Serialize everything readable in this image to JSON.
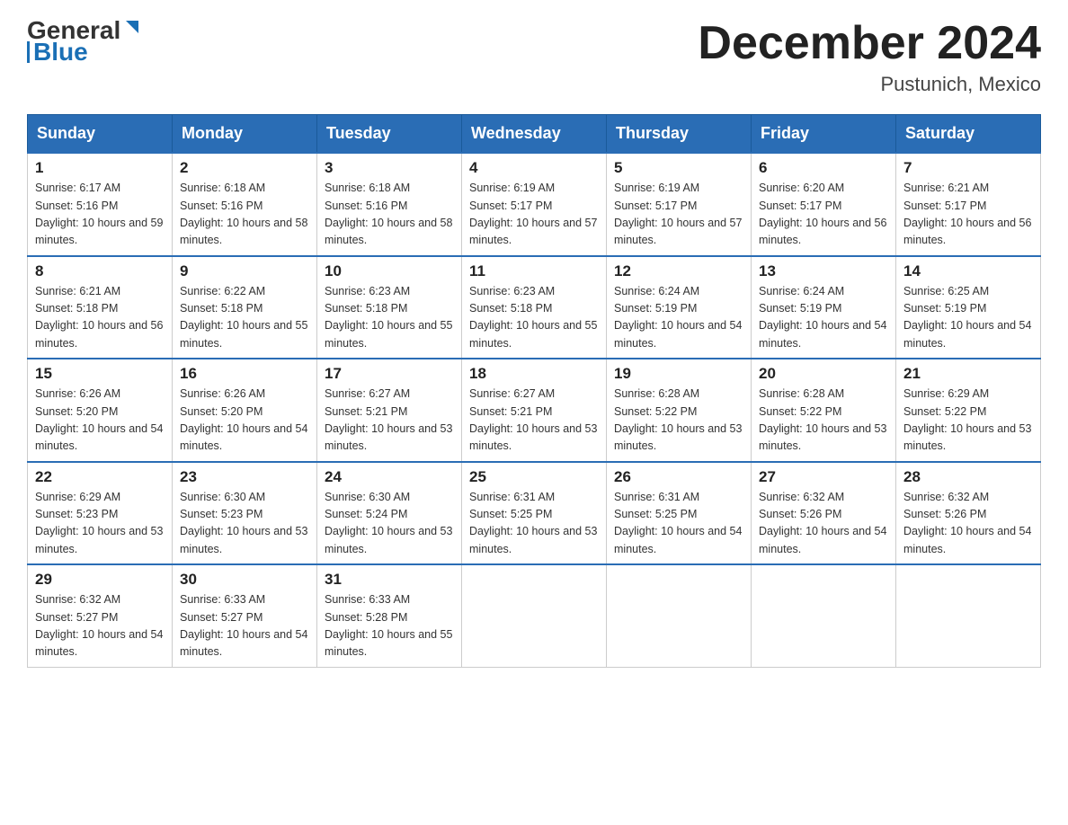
{
  "header": {
    "logo": {
      "text_general": "General",
      "text_blue": "Blue"
    },
    "title": "December 2024",
    "location": "Pustunich, Mexico"
  },
  "days_of_week": [
    "Sunday",
    "Monday",
    "Tuesday",
    "Wednesday",
    "Thursday",
    "Friday",
    "Saturday"
  ],
  "weeks": [
    [
      {
        "day": "1",
        "sunrise": "6:17 AM",
        "sunset": "5:16 PM",
        "daylight": "10 hours and 59 minutes."
      },
      {
        "day": "2",
        "sunrise": "6:18 AM",
        "sunset": "5:16 PM",
        "daylight": "10 hours and 58 minutes."
      },
      {
        "day": "3",
        "sunrise": "6:18 AM",
        "sunset": "5:16 PM",
        "daylight": "10 hours and 58 minutes."
      },
      {
        "day": "4",
        "sunrise": "6:19 AM",
        "sunset": "5:17 PM",
        "daylight": "10 hours and 57 minutes."
      },
      {
        "day": "5",
        "sunrise": "6:19 AM",
        "sunset": "5:17 PM",
        "daylight": "10 hours and 57 minutes."
      },
      {
        "day": "6",
        "sunrise": "6:20 AM",
        "sunset": "5:17 PM",
        "daylight": "10 hours and 56 minutes."
      },
      {
        "day": "7",
        "sunrise": "6:21 AM",
        "sunset": "5:17 PM",
        "daylight": "10 hours and 56 minutes."
      }
    ],
    [
      {
        "day": "8",
        "sunrise": "6:21 AM",
        "sunset": "5:18 PM",
        "daylight": "10 hours and 56 minutes."
      },
      {
        "day": "9",
        "sunrise": "6:22 AM",
        "sunset": "5:18 PM",
        "daylight": "10 hours and 55 minutes."
      },
      {
        "day": "10",
        "sunrise": "6:23 AM",
        "sunset": "5:18 PM",
        "daylight": "10 hours and 55 minutes."
      },
      {
        "day": "11",
        "sunrise": "6:23 AM",
        "sunset": "5:18 PM",
        "daylight": "10 hours and 55 minutes."
      },
      {
        "day": "12",
        "sunrise": "6:24 AM",
        "sunset": "5:19 PM",
        "daylight": "10 hours and 54 minutes."
      },
      {
        "day": "13",
        "sunrise": "6:24 AM",
        "sunset": "5:19 PM",
        "daylight": "10 hours and 54 minutes."
      },
      {
        "day": "14",
        "sunrise": "6:25 AM",
        "sunset": "5:19 PM",
        "daylight": "10 hours and 54 minutes."
      }
    ],
    [
      {
        "day": "15",
        "sunrise": "6:26 AM",
        "sunset": "5:20 PM",
        "daylight": "10 hours and 54 minutes."
      },
      {
        "day": "16",
        "sunrise": "6:26 AM",
        "sunset": "5:20 PM",
        "daylight": "10 hours and 54 minutes."
      },
      {
        "day": "17",
        "sunrise": "6:27 AM",
        "sunset": "5:21 PM",
        "daylight": "10 hours and 53 minutes."
      },
      {
        "day": "18",
        "sunrise": "6:27 AM",
        "sunset": "5:21 PM",
        "daylight": "10 hours and 53 minutes."
      },
      {
        "day": "19",
        "sunrise": "6:28 AM",
        "sunset": "5:22 PM",
        "daylight": "10 hours and 53 minutes."
      },
      {
        "day": "20",
        "sunrise": "6:28 AM",
        "sunset": "5:22 PM",
        "daylight": "10 hours and 53 minutes."
      },
      {
        "day": "21",
        "sunrise": "6:29 AM",
        "sunset": "5:22 PM",
        "daylight": "10 hours and 53 minutes."
      }
    ],
    [
      {
        "day": "22",
        "sunrise": "6:29 AM",
        "sunset": "5:23 PM",
        "daylight": "10 hours and 53 minutes."
      },
      {
        "day": "23",
        "sunrise": "6:30 AM",
        "sunset": "5:23 PM",
        "daylight": "10 hours and 53 minutes."
      },
      {
        "day": "24",
        "sunrise": "6:30 AM",
        "sunset": "5:24 PM",
        "daylight": "10 hours and 53 minutes."
      },
      {
        "day": "25",
        "sunrise": "6:31 AM",
        "sunset": "5:25 PM",
        "daylight": "10 hours and 53 minutes."
      },
      {
        "day": "26",
        "sunrise": "6:31 AM",
        "sunset": "5:25 PM",
        "daylight": "10 hours and 54 minutes."
      },
      {
        "day": "27",
        "sunrise": "6:32 AM",
        "sunset": "5:26 PM",
        "daylight": "10 hours and 54 minutes."
      },
      {
        "day": "28",
        "sunrise": "6:32 AM",
        "sunset": "5:26 PM",
        "daylight": "10 hours and 54 minutes."
      }
    ],
    [
      {
        "day": "29",
        "sunrise": "6:32 AM",
        "sunset": "5:27 PM",
        "daylight": "10 hours and 54 minutes."
      },
      {
        "day": "30",
        "sunrise": "6:33 AM",
        "sunset": "5:27 PM",
        "daylight": "10 hours and 54 minutes."
      },
      {
        "day": "31",
        "sunrise": "6:33 AM",
        "sunset": "5:28 PM",
        "daylight": "10 hours and 55 minutes."
      },
      null,
      null,
      null,
      null
    ]
  ],
  "labels": {
    "sunrise": "Sunrise:",
    "sunset": "Sunset:",
    "daylight": "Daylight:"
  }
}
